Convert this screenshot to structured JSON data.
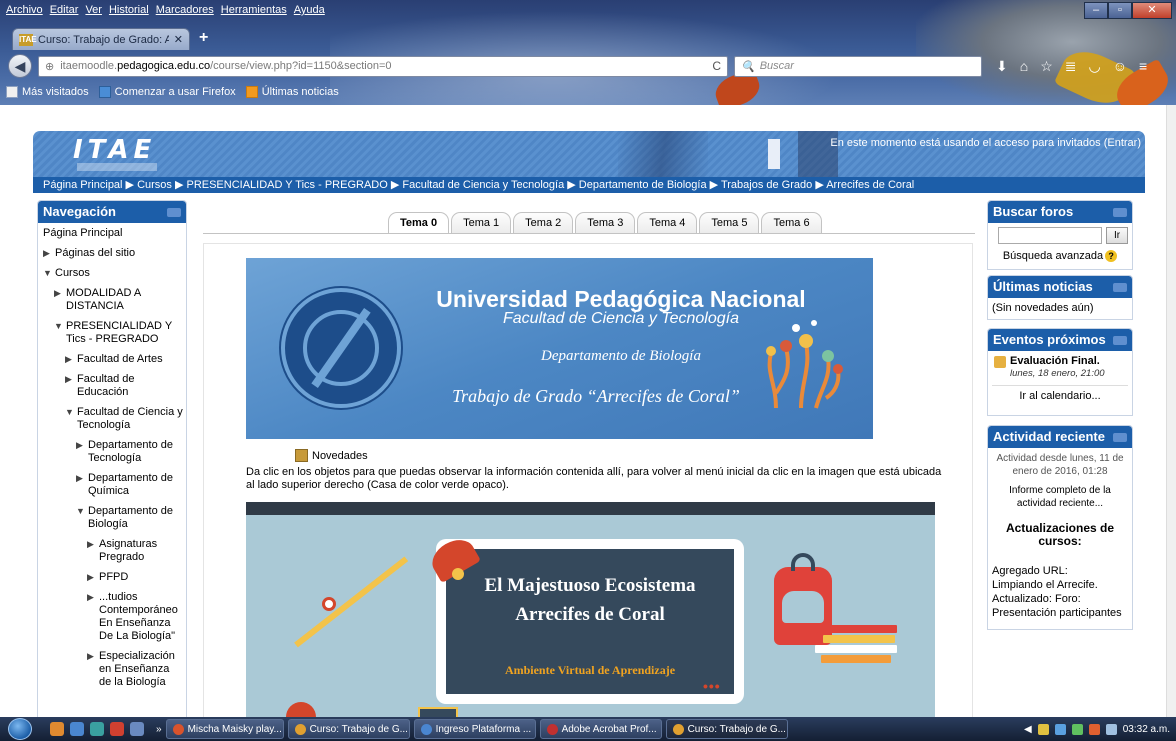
{
  "browser": {
    "menu": [
      "Archivo",
      "Editar",
      "Ver",
      "Historial",
      "Marcadores",
      "Herramientas",
      "Ayuda"
    ],
    "tab_title": "Curso: Trabajo de Grado: A...",
    "tab_favicon": "ITAE",
    "url_prefix": "itaemoodle.",
    "url_host": "pedagogica.edu.co",
    "url_path": "/course/view.php?id=1150&section=0",
    "search_placeholder": "Buscar",
    "bookmarks": [
      "Más visitados",
      "Comenzar a usar Firefox",
      "Últimas noticias"
    ]
  },
  "header": {
    "logo": "ITAE",
    "login_text": "En este momento está usando el acceso para invitados (Entrar)"
  },
  "breadcrumb": "Página Principal ▶ Cursos ▶ PRESENCIALIDAD Y Tics - PREGRADO ▶ Facultad de Ciencia y Tecnología ▶ Departamento de Biología ▶ Trabajos de Grado ▶ Arrecifes de Coral",
  "navigation": {
    "title": "Navegación",
    "items": [
      {
        "label": "Página Principal",
        "arrow": "",
        "indent": 0
      },
      {
        "label": "Páginas del sitio",
        "arrow": "▶",
        "indent": 0
      },
      {
        "label": "Cursos",
        "arrow": "▼",
        "indent": 0
      },
      {
        "label": "MODALIDAD A DISTANCIA",
        "arrow": "▶",
        "indent": 1
      },
      {
        "label": "PRESENCIALIDAD Y Tics - PREGRADO",
        "arrow": "▼",
        "indent": 1
      },
      {
        "label": "Facultad de Artes",
        "arrow": "▶",
        "indent": 2
      },
      {
        "label": "Facultad de Educación",
        "arrow": "▶",
        "indent": 2
      },
      {
        "label": "Facultad de Ciencia y Tecnología",
        "arrow": "▼",
        "indent": 2
      },
      {
        "label": "Departamento de Tecnología",
        "arrow": "▶",
        "indent": 3
      },
      {
        "label": "Departamento de Química",
        "arrow": "▶",
        "indent": 3
      },
      {
        "label": "Departamento de Biología",
        "arrow": "▼",
        "indent": 3
      },
      {
        "label": "Asignaturas Pregrado",
        "arrow": "▶",
        "indent": 4
      },
      {
        "label": "PFPD",
        "arrow": "▶",
        "indent": 4
      },
      {
        "label": "...tudios Contemporáneo En Enseñanza De La Biología\"",
        "arrow": "▶",
        "indent": 4
      },
      {
        "label": "Especialización en Enseñanza de la Biología",
        "arrow": "▶",
        "indent": 4
      }
    ]
  },
  "tabs": [
    "Tema 0",
    "Tema 1",
    "Tema 2",
    "Tema 3",
    "Tema 4",
    "Tema 5",
    "Tema 6"
  ],
  "banner": {
    "line1": "Universidad Pedagógica Nacional",
    "line2": "Facultad de Ciencia y Tecnología",
    "line3": "Departamento de Biología",
    "line4": "Trabajo de Grado “Arrecifes de Coral”"
  },
  "novedades": "Novedades",
  "instruction": "Da clic en los objetos para que puedas observar la información contenida allí, para volver al menú inicial da clic en la imagen que está ubicada al lado superior derecho (Casa de color verde opaco).",
  "eco": {
    "title": "El Majestuoso Ecosistema Arrecifes de Coral",
    "subtitle": "Ambiente Virtual de Aprendizaje",
    "dots": "•••"
  },
  "buscar_foros": {
    "title": "Buscar foros",
    "button": "Ir",
    "advanced": "Búsqueda avanzada"
  },
  "ultimas_noticias": {
    "title": "Últimas noticias",
    "empty": "(Sin novedades aún)"
  },
  "eventos": {
    "title": "Eventos próximos",
    "event_title": "Evaluación Final.",
    "event_date": "lunes, 18 enero, 21:00",
    "calendar_link": "Ir al calendario..."
  },
  "actividad": {
    "title": "Actividad reciente",
    "since": "Actividad desde lunes, 11 de enero de 2016, 01:28",
    "report": "Informe completo de la actividad reciente...",
    "updates_title": "Actualizaciones de cursos:",
    "log": [
      "Agregado URL:",
      "Limpiando el Arrecife.",
      "Actualizado: Foro:",
      "Presentación participantes"
    ]
  },
  "taskbar": {
    "buttons": [
      {
        "label": "Mischa Maisky play...",
        "color": "#d9532c"
      },
      {
        "label": "Curso: Trabajo de G...",
        "color": "#e0a030"
      },
      {
        "label": "Ingreso Plataforma ...",
        "color": "#4a86d0"
      },
      {
        "label": "Adobe Acrobat Prof...",
        "color": "#c03030"
      },
      {
        "label": "Curso: Trabajo de G...",
        "color": "#e0a030"
      }
    ],
    "clock": "03:32 a.m."
  }
}
